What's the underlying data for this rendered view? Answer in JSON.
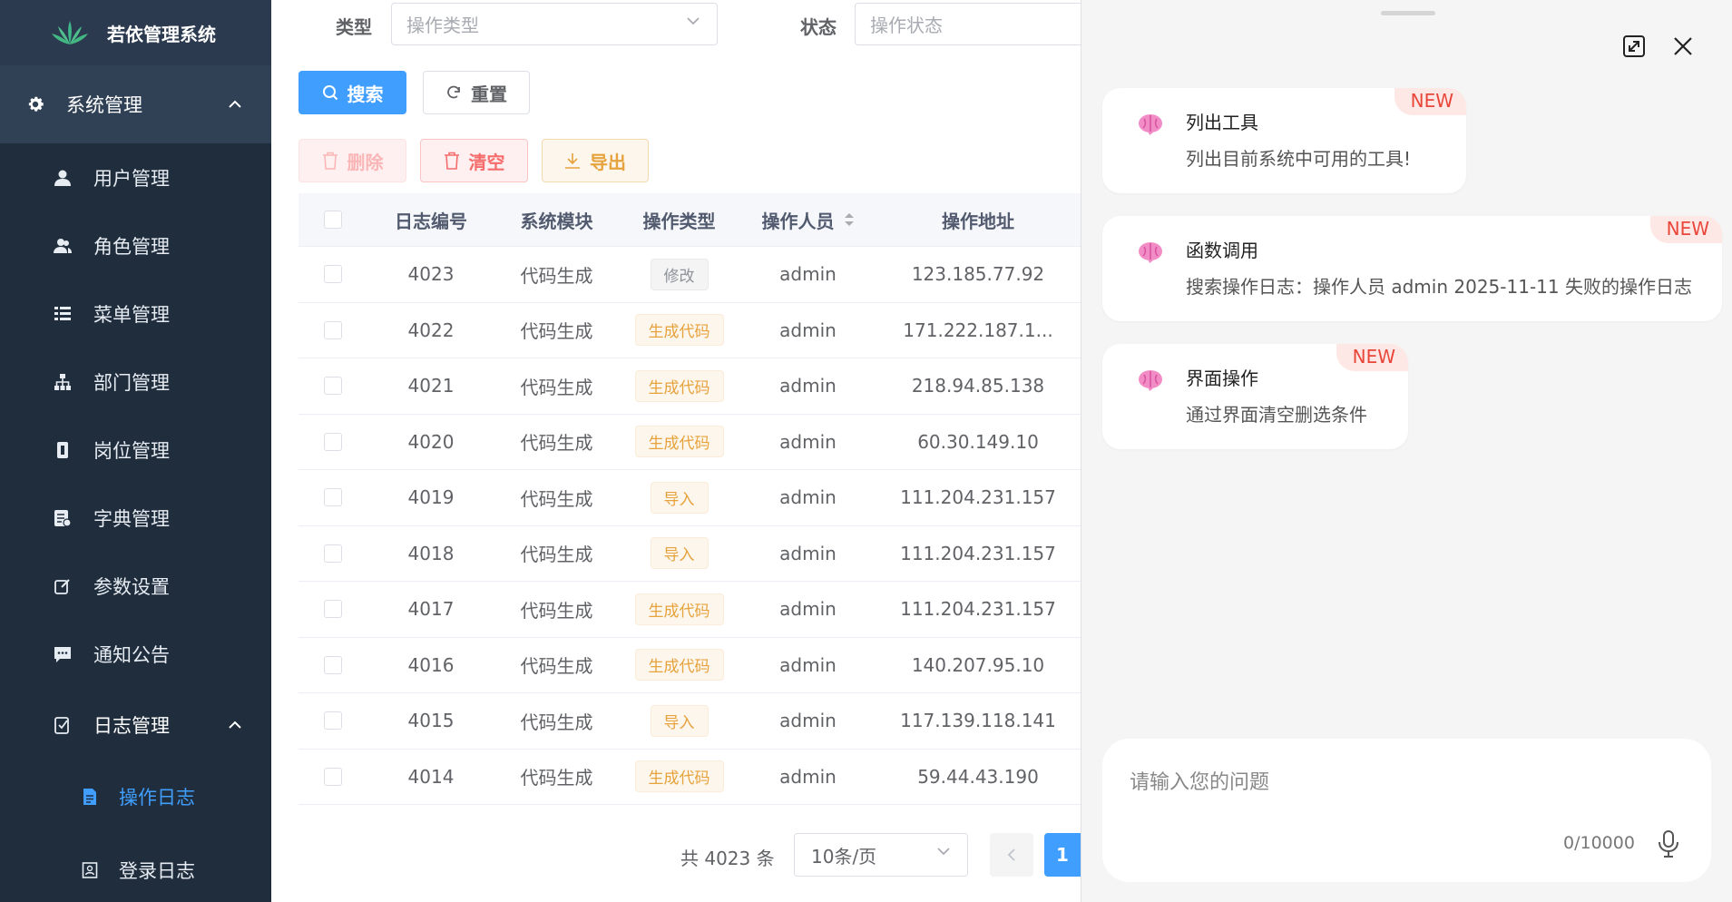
{
  "sidebar": {
    "logo_text": "若依管理系统",
    "section": "系统管理",
    "items": [
      {
        "label": "用户管理",
        "icon": "user-icon"
      },
      {
        "label": "角色管理",
        "icon": "peoples-icon"
      },
      {
        "label": "菜单管理",
        "icon": "tree-table-icon"
      },
      {
        "label": "部门管理",
        "icon": "tree-icon"
      },
      {
        "label": "岗位管理",
        "icon": "post-icon"
      },
      {
        "label": "字典管理",
        "icon": "dict-icon"
      },
      {
        "label": "参数设置",
        "icon": "edit-icon"
      },
      {
        "label": "通知公告",
        "icon": "message-icon"
      }
    ],
    "log_group": "日志管理",
    "log_items": [
      {
        "label": "操作日志",
        "active": true
      },
      {
        "label": "登录日志",
        "active": false
      }
    ]
  },
  "filters": {
    "type_label": "类型",
    "type_placeholder": "操作类型",
    "status_label": "状态",
    "status_placeholder": "操作状态"
  },
  "toolbar": {
    "search": "搜索",
    "reset": "重置",
    "delete": "删除",
    "clear": "清空",
    "export": "导出"
  },
  "table": {
    "headers": [
      "日志编号",
      "系统模块",
      "操作类型",
      "操作人员",
      "操作地址"
    ],
    "rows": [
      {
        "id": "4023",
        "module": "代码生成",
        "type": "修改",
        "type_style": "info",
        "user": "admin",
        "ip": "123.185.77.92"
      },
      {
        "id": "4022",
        "module": "代码生成",
        "type": "生成代码",
        "type_style": "warn",
        "user": "admin",
        "ip": "171.222.187.1..."
      },
      {
        "id": "4021",
        "module": "代码生成",
        "type": "生成代码",
        "type_style": "warn",
        "user": "admin",
        "ip": "218.94.85.138"
      },
      {
        "id": "4020",
        "module": "代码生成",
        "type": "生成代码",
        "type_style": "warn",
        "user": "admin",
        "ip": "60.30.149.10"
      },
      {
        "id": "4019",
        "module": "代码生成",
        "type": "导入",
        "type_style": "warn",
        "user": "admin",
        "ip": "111.204.231.157"
      },
      {
        "id": "4018",
        "module": "代码生成",
        "type": "导入",
        "type_style": "warn",
        "user": "admin",
        "ip": "111.204.231.157"
      },
      {
        "id": "4017",
        "module": "代码生成",
        "type": "生成代码",
        "type_style": "warn",
        "user": "admin",
        "ip": "111.204.231.157"
      },
      {
        "id": "4016",
        "module": "代码生成",
        "type": "生成代码",
        "type_style": "warn",
        "user": "admin",
        "ip": "140.207.95.10"
      },
      {
        "id": "4015",
        "module": "代码生成",
        "type": "导入",
        "type_style": "warn",
        "user": "admin",
        "ip": "117.139.118.141"
      },
      {
        "id": "4014",
        "module": "代码生成",
        "type": "生成代码",
        "type_style": "warn",
        "user": "admin",
        "ip": "59.44.43.190"
      }
    ]
  },
  "pagination": {
    "total": "共 4023 条",
    "page_size": "10条/页",
    "current_page": "1"
  },
  "chat": {
    "cards": [
      {
        "title": "列出工具",
        "desc": "列出目前系统中可用的工具!",
        "badge": "NEW"
      },
      {
        "title": "函数调用",
        "desc": "搜索操作日志：操作人员 admin 2025-11-11 失败的操作日志",
        "badge": "NEW"
      },
      {
        "title": "界面操作",
        "desc": "通过界面清空删选条件",
        "badge": "NEW"
      }
    ],
    "input_placeholder": "请输入您的问题",
    "char_count": "0/10000"
  },
  "colors": {
    "sidebar_bg": "#304156",
    "submenu_bg": "#1f2d3d",
    "primary": "#409eff",
    "danger": "#f56c6c",
    "warning": "#e6a23c",
    "badge_text": "#e9463a"
  }
}
